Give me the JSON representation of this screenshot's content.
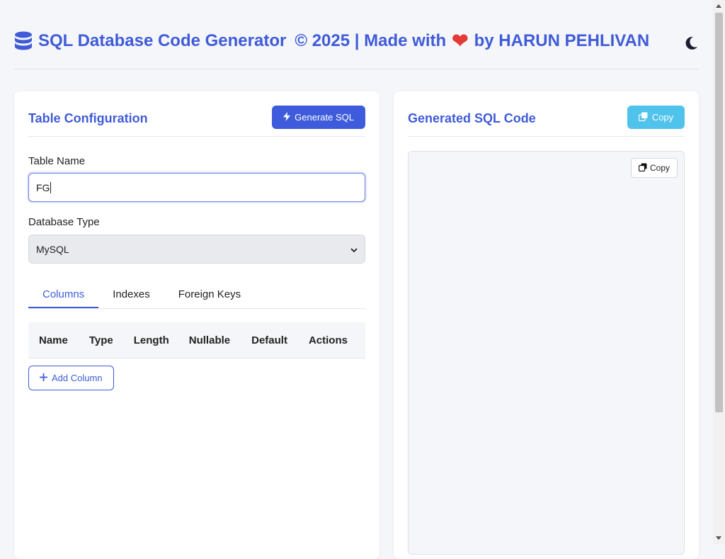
{
  "header": {
    "title": "SQL Database Code Generator",
    "copyright": "© 2025 | Made with",
    "heart": "❤",
    "author": "by HARUN PEHLIVAN",
    "icons": {
      "logo": "database-icon",
      "theme": "moon-icon"
    }
  },
  "left": {
    "title": "Table Configuration",
    "generate_label": "Generate SQL",
    "table_name_label": "Table Name",
    "table_name_value": "FG",
    "db_type_label": "Database Type",
    "db_type_value": "MySQL",
    "tabs": [
      {
        "label": "Columns",
        "active": true
      },
      {
        "label": "Indexes",
        "active": false
      },
      {
        "label": "Foreign Keys",
        "active": false
      }
    ],
    "columns_headers": [
      "Name",
      "Type",
      "Length",
      "Nullable",
      "Default",
      "Actions"
    ],
    "add_column_label": "Add Column"
  },
  "right": {
    "title": "Generated SQL Code",
    "copy_label": "Copy",
    "code_copy_label": "Copy",
    "code": ""
  },
  "colors": {
    "accent": "#3e5bdc",
    "info": "#4fc3ec",
    "heart": "#e53935"
  }
}
